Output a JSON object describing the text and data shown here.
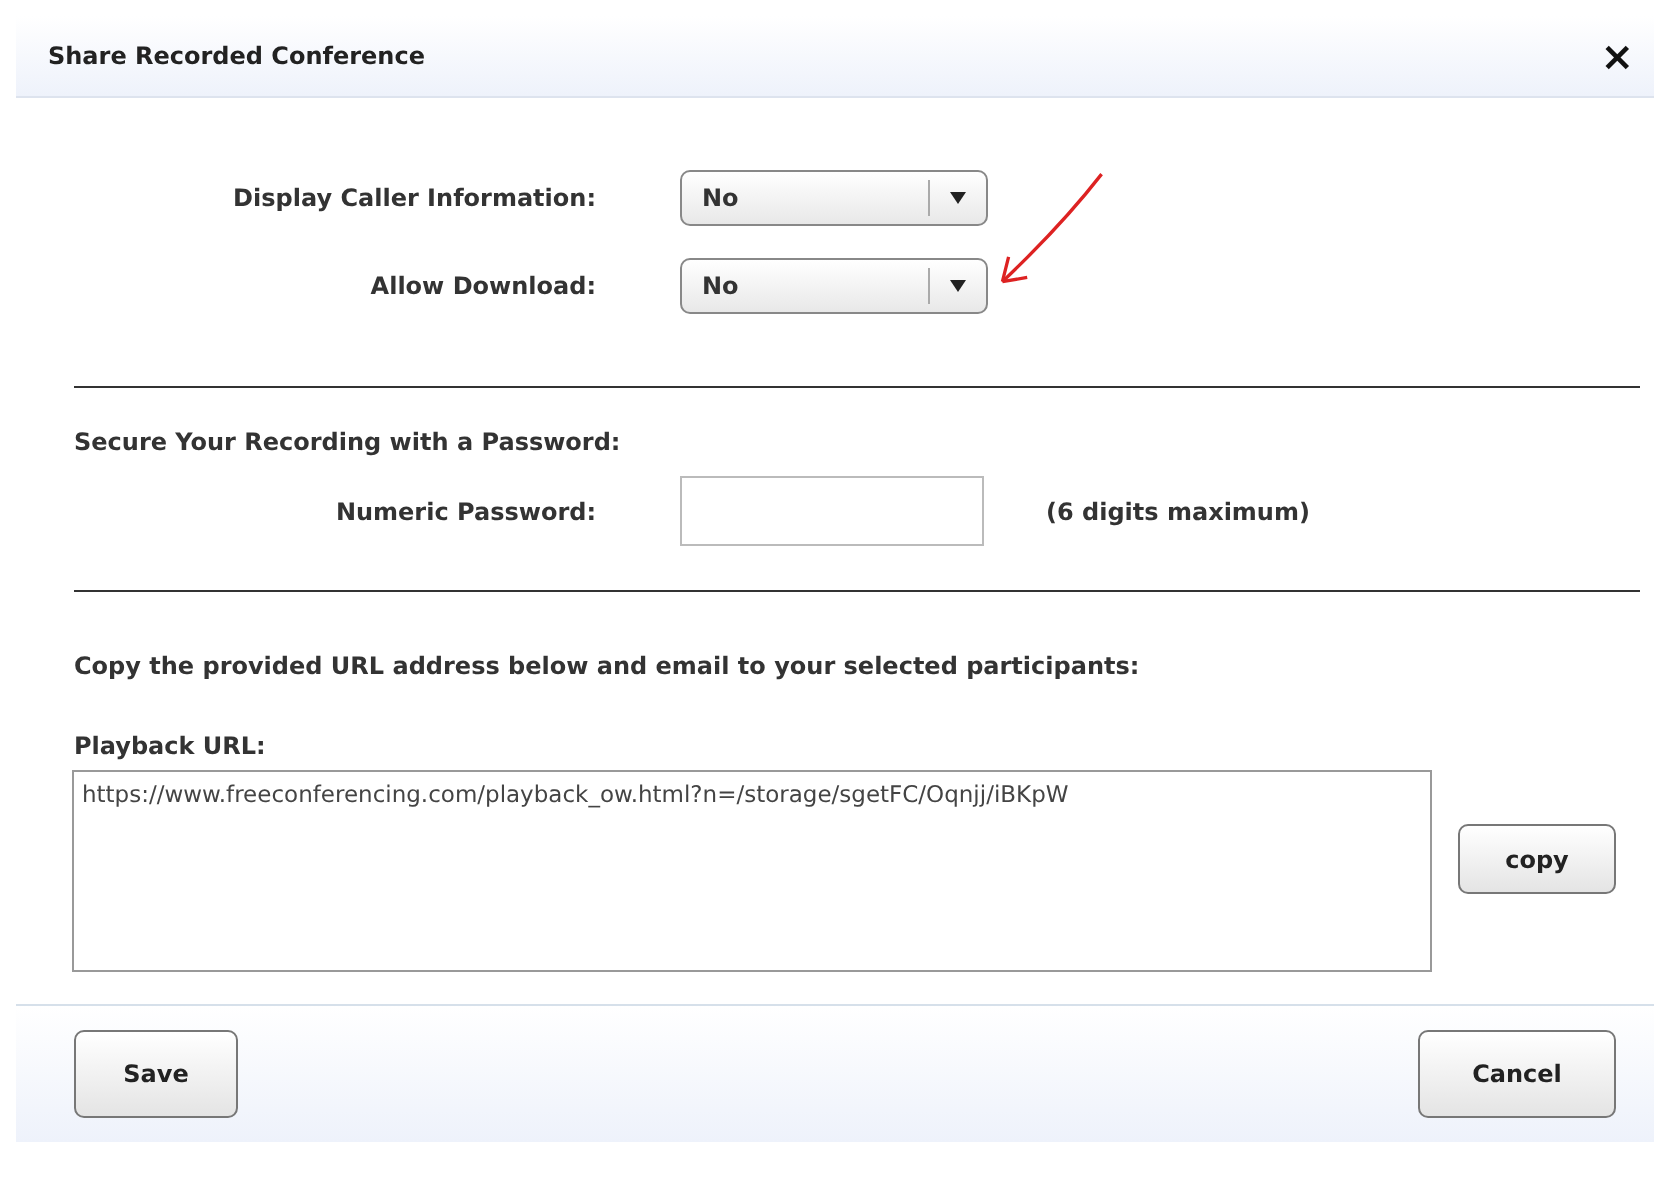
{
  "dialog": {
    "title": "Share Recorded Conference",
    "close": "×"
  },
  "options": [
    {
      "label": "Display Caller Information:",
      "value": "No"
    },
    {
      "label": "Allow Download:",
      "value": "No"
    }
  ],
  "password_section": {
    "heading": "Secure Your Recording with a Password:",
    "label": "Numeric Password:",
    "hint": "(6 digits maximum)"
  },
  "url_section": {
    "instruction": "Copy the provided URL address below and email to your selected participants:",
    "label": "Playback URL:",
    "value": "https://www.freeconferencing.com/playback_ow.html?n=/storage/sgetFC/Oqnjj/iBKpW",
    "copy_button": "copy"
  },
  "buttons": [
    {
      "label": "Save",
      "kind": "primary"
    },
    {
      "label": "Cancel",
      "kind": "secondary"
    }
  ]
}
